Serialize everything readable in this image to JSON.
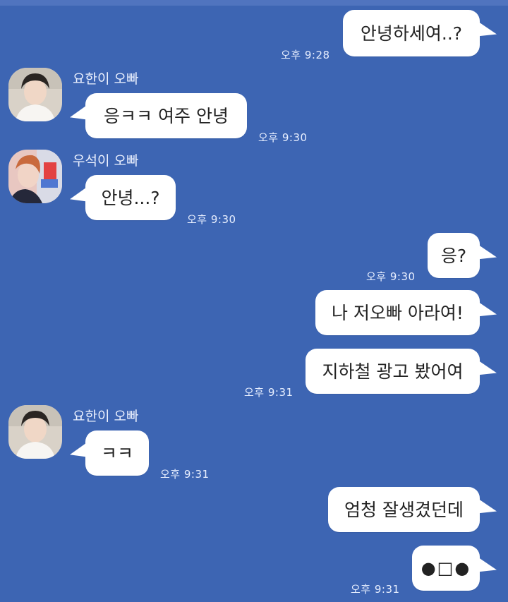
{
  "chat": {
    "messages": [
      {
        "text": "안녕하세여..?",
        "time": "오후 9:28"
      },
      {
        "sender": "요한이 오빠",
        "text": "응ㅋㅋ 여주 안녕",
        "time": "오후 9:30"
      },
      {
        "sender": "우석이 오빠",
        "text": "안녕...?",
        "time": "오후 9:30"
      },
      {
        "text": "응?",
        "time": "오후 9:30"
      },
      {
        "text": "나 저오빠 아라여!"
      },
      {
        "text": "지하철 광고 봤어여",
        "time": "오후 9:31"
      },
      {
        "sender": "요한이 오빠",
        "text": "ㅋㅋ",
        "time": "오후 9:31"
      },
      {
        "text": "엄청 잘생겼던데"
      },
      {
        "text": "●□●",
        "time": "오후 9:31"
      }
    ]
  },
  "icons": {
    "avatar_yohan": "profile-photo-yohan",
    "avatar_wooseok": "profile-photo-wooseok"
  },
  "colors": {
    "background": "#3d65b3",
    "bubble": "#ffffff",
    "time_text": "#e8efff",
    "name_text": "#edf2ff"
  }
}
